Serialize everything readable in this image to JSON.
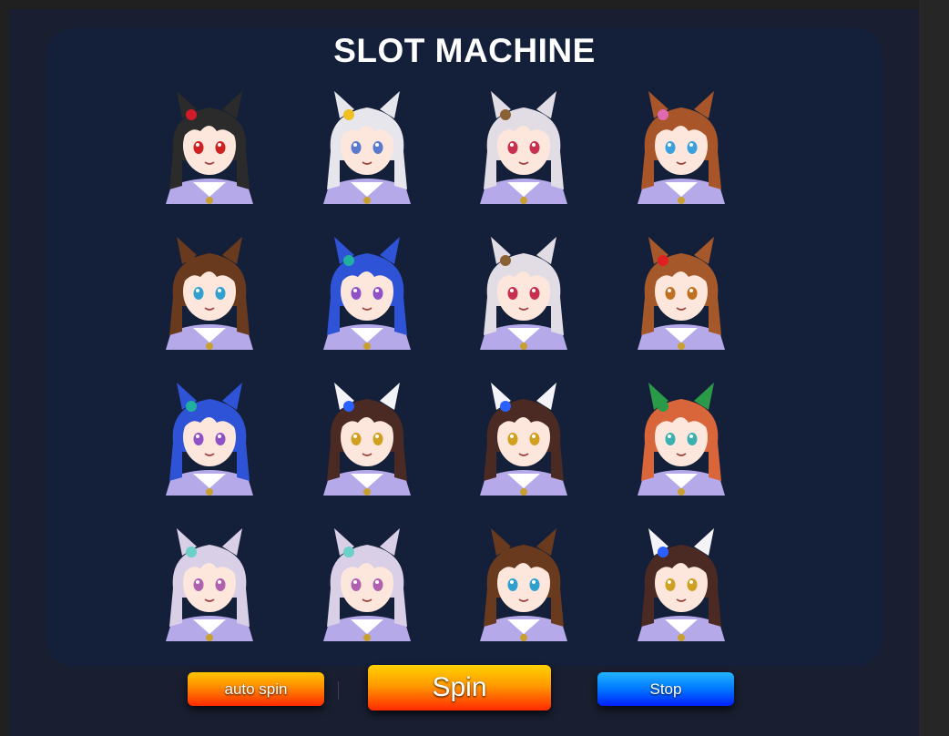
{
  "title": "SLOT MACHINE",
  "reels": [
    [
      {
        "icon": "character-black-hair-red-ribbon-icon",
        "hair": "#2b2b2b",
        "accent": "#d01c28",
        "eyes": "#d02020",
        "ears": "#2b2b2b"
      },
      {
        "icon": "character-silver-hair-gold-tiara-icon",
        "hair": "#e6e6ec",
        "accent": "#f0c020",
        "eyes": "#5a7ad0",
        "ears": "#e6e6ec"
      },
      {
        "icon": "character-silver-hair-brown-hat-icon",
        "hair": "#e2dde4",
        "accent": "#8a6035",
        "eyes": "#c83050",
        "ears": "#e2dde4"
      },
      {
        "icon": "character-brown-hair-pink-bow-icon",
        "hair": "#a8552a",
        "accent": "#e06ab0",
        "eyes": "#3aa0e0",
        "ears": "#a8552a"
      }
    ],
    [
      {
        "icon": "character-brown-ponytail-glasses-icon",
        "hair": "#6a3a1e",
        "accent": "#6a3a1e",
        "eyes": "#30a0d0",
        "ears": "#6a3a1e"
      },
      {
        "icon": "character-blue-twintails-icon",
        "hair": "#2f53d6",
        "accent": "#1fb0a0",
        "eyes": "#9050c8",
        "ears": "#2f53d6"
      },
      {
        "icon": "character-silver-hair-brown-hat-icon",
        "hair": "#e2dde4",
        "accent": "#8a6035",
        "eyes": "#c83050",
        "ears": "#e2dde4"
      },
      {
        "icon": "character-brown-short-hair-red-flower-icon",
        "hair": "#a5582a",
        "accent": "#e02020",
        "eyes": "#c07020",
        "ears": "#a5582a"
      }
    ],
    [
      {
        "icon": "character-blue-twintails-icon",
        "hair": "#2f53d6",
        "accent": "#1fb0a0",
        "eyes": "#9050c8",
        "ears": "#2f53d6"
      },
      {
        "icon": "character-brown-hair-blue-streak-icon",
        "hair": "#4a2a22",
        "accent": "#2a60ff",
        "eyes": "#d0a020",
        "ears": "#f4f4f8"
      },
      {
        "icon": "character-brown-hair-blue-streak-icon",
        "hair": "#4a2a22",
        "accent": "#2a60ff",
        "eyes": "#d0a020",
        "ears": "#f4f4f8"
      },
      {
        "icon": "character-orange-long-hair-green-icon",
        "hair": "#d8663a",
        "accent": "#2a9a48",
        "eyes": "#3ab0b0",
        "ears": "#2a9a48"
      }
    ],
    [
      {
        "icon": "character-lavender-long-hair-icon",
        "hair": "#d9cfe6",
        "accent": "#6ad0c8",
        "eyes": "#b060b0",
        "ears": "#d9cfe6"
      },
      {
        "icon": "character-lavender-long-hair-icon",
        "hair": "#d9cfe6",
        "accent": "#6ad0c8",
        "eyes": "#b060b0",
        "ears": "#d9cfe6"
      },
      {
        "icon": "character-brown-ponytail-glasses-icon",
        "hair": "#6a3a1e",
        "accent": "#6a3a1e",
        "eyes": "#30a0d0",
        "ears": "#6a3a1e"
      },
      {
        "icon": "character-brown-hair-blue-streak-icon",
        "hair": "#4a2a22",
        "accent": "#2a60ff",
        "eyes": "#d0a020",
        "ears": "#f4f4f8"
      }
    ]
  ],
  "controls": {
    "auto_spin": "auto spin",
    "spin": "Spin",
    "stop": "Stop"
  },
  "colors": {
    "background": "#191e30",
    "panel": "#142039",
    "uniform": "#b6a9ea",
    "skin": "#fde7dc"
  }
}
